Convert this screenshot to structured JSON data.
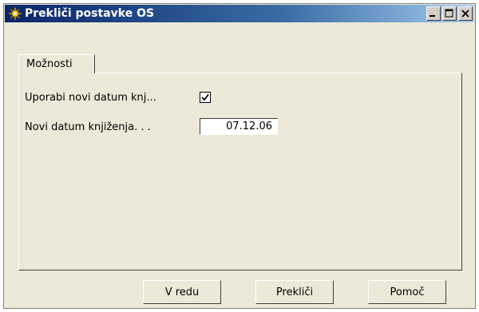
{
  "window": {
    "title": "Prekliči postavke OS",
    "title_icon": "gear-sun-icon",
    "buttons": [
      "minimize-icon",
      "maximize-icon",
      "close-icon"
    ]
  },
  "tabs": [
    {
      "label": "Možnosti",
      "active": true
    }
  ],
  "form": {
    "use_new_date_label": "Uporabi novi datum knj...",
    "use_new_date_checked": true,
    "new_date_label": "Novi datum knjiženja. . .",
    "new_date_value": "07.12.06"
  },
  "footer": {
    "ok_label": "V redu",
    "cancel_label": "Prekliči",
    "help_label": "Pomoč"
  },
  "colors": {
    "dialog_bg": "#ece9d8",
    "titlebar_start": "#0a246a",
    "titlebar_end": "#a6caf0"
  }
}
